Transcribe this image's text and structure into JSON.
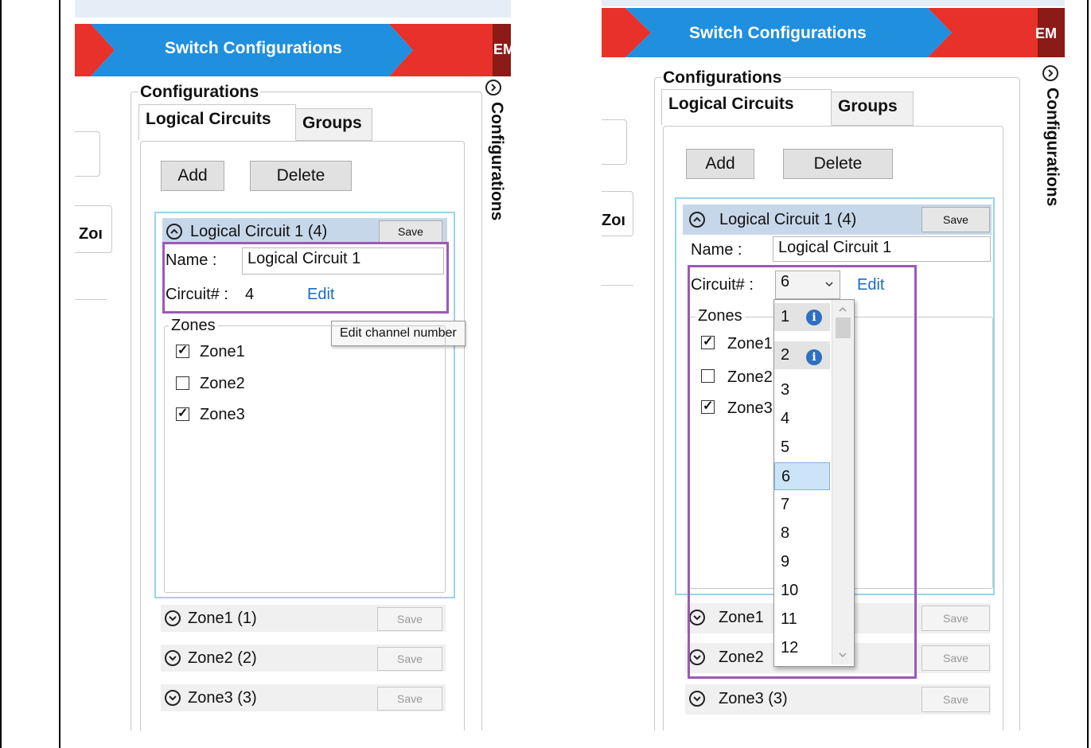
{
  "left": {
    "banner_title": "Switch Configurations",
    "banner_em": "EM",
    "group_label": "Configurations",
    "tabs": [
      "Logical Circuits",
      "Groups"
    ],
    "add_label": "Add",
    "delete_label": "Delete",
    "side_text": "Zoı",
    "expander": {
      "title": "Logical Circuit 1 (4)",
      "save_label": "Save",
      "name_label": "Name :",
      "name_value": "Logical Circuit 1",
      "circuit_label": "Circuit# :",
      "circuit_value": "4",
      "edit_label": "Edit",
      "tooltip": "Edit channel number",
      "zones_label": "Zones",
      "zones": [
        {
          "label": "Zone1",
          "checked": true
        },
        {
          "label": "Zone2",
          "checked": false
        },
        {
          "label": "Zone3",
          "checked": true
        }
      ]
    },
    "collapsed": [
      {
        "title": "Zone1 (1)",
        "save": "Save"
      },
      {
        "title": "Zone2 (2)",
        "save": "Save"
      },
      {
        "title": "Zone3 (3)",
        "save": "Save"
      }
    ],
    "side_configurations": "Configurations"
  },
  "right": {
    "banner_title": "Switch Configurations",
    "banner_em": "EM",
    "group_label": "Configurations",
    "tabs": [
      "Logical Circuits",
      "Groups"
    ],
    "add_label": "Add",
    "delete_label": "Delete",
    "side_text": "Zoı",
    "expander": {
      "title": "Logical Circuit 1 (4)",
      "save_label": "Save",
      "name_label": "Name :",
      "name_value": "Logical Circuit 1",
      "circuit_label": "Circuit# :",
      "circuit_value": "6",
      "edit_label": "Edit",
      "zones_label": "Zones",
      "zones": [
        {
          "label": "Zone1",
          "checked": true
        },
        {
          "label": "Zone2",
          "checked": false
        },
        {
          "label": "Zone3",
          "checked": true
        }
      ]
    },
    "dropdown_options": [
      "1",
      "2",
      "3",
      "4",
      "5",
      "6",
      "7",
      "8",
      "9",
      "10",
      "11",
      "12"
    ],
    "dropdown_selected": "6",
    "collapsed": [
      {
        "title": "Zone1",
        "save": "Save"
      },
      {
        "title": "Zone2",
        "save": "Save"
      },
      {
        "title": "Zone3 (3)",
        "save": "Save"
      }
    ],
    "side_configurations": "Configurations"
  },
  "colors": {
    "banner_blue": "#1f8fde",
    "banner_red": "#e8312a",
    "accent_purple": "#9b59b6",
    "link_blue": "#1a6bc6"
  }
}
